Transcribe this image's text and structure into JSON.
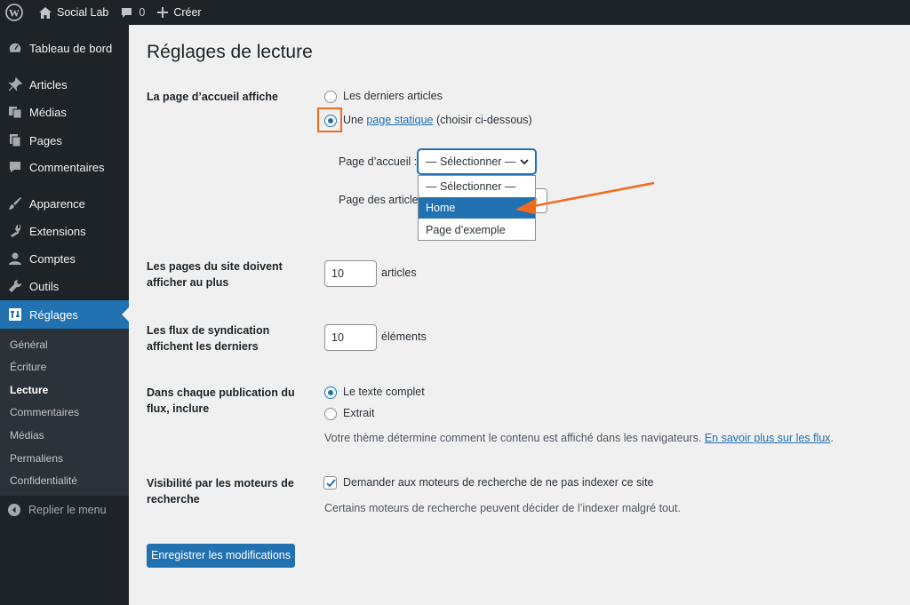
{
  "admin_bar": {
    "site_name": "Social Lab",
    "comments_count": "0",
    "new_label": "Créer"
  },
  "sidebar": {
    "items": [
      {
        "label": "Tableau de bord",
        "icon": "dashboard-icon"
      },
      {
        "label": "Articles",
        "icon": "pin-icon"
      },
      {
        "label": "Médias",
        "icon": "media-icon"
      },
      {
        "label": "Pages",
        "icon": "pages-icon"
      },
      {
        "label": "Commentaires",
        "icon": "comments-icon"
      },
      {
        "label": "Apparence",
        "icon": "brush-icon"
      },
      {
        "label": "Extensions",
        "icon": "plugin-icon"
      },
      {
        "label": "Comptes",
        "icon": "user-icon"
      },
      {
        "label": "Outils",
        "icon": "wrench-icon"
      },
      {
        "label": "Réglages",
        "icon": "settings-icon"
      }
    ],
    "submenu": [
      "Général",
      "Écriture",
      "Lecture",
      "Commentaires",
      "Médias",
      "Permaliens",
      "Confidentialité"
    ],
    "collapse_label": "Replier le menu"
  },
  "page": {
    "title": "Réglages de lecture",
    "homepage": {
      "label": "La page d’accueil affiche",
      "option_latest": "Les derniers articles",
      "option_static_prefix": "Une",
      "option_static_link": "page statique",
      "option_static_suffix": "(choisir ci-dessous)",
      "front_page_label": "Page d’accueil :",
      "front_page_value": "— Sélectionner —",
      "posts_page_label": "Page des articles",
      "dropdown_options": [
        "— Sélectionner —",
        "Home",
        "Page d’exemple"
      ]
    },
    "posts_per_page": {
      "label": "Les pages du site doivent afficher au plus",
      "value": "10",
      "unit": "articles"
    },
    "feed_items": {
      "label": "Les flux de syndication affichent les derniers",
      "value": "10",
      "unit": "éléments"
    },
    "feed_content": {
      "label": "Dans chaque publication du flux, inclure",
      "option_full": "Le texte complet",
      "option_excerpt": "Extrait",
      "description": "Votre thème détermine comment le contenu est affiché dans les navigateurs.",
      "link": "En savoir plus sur les flux",
      "link_suffix": "."
    },
    "search_visibility": {
      "label": "Visibilité par les moteurs de recherche",
      "checkbox_label": "Demander aux moteurs de recherche de ne pas indexer ce site",
      "description": "Certains moteurs de recherche peuvent décider de l’indexer malgré tout."
    },
    "save_label": "Enregistrer les modifications"
  },
  "colors": {
    "accent": "#2271b1",
    "annotation": "#f06b1d",
    "sidebar_bg": "#1d2327"
  }
}
